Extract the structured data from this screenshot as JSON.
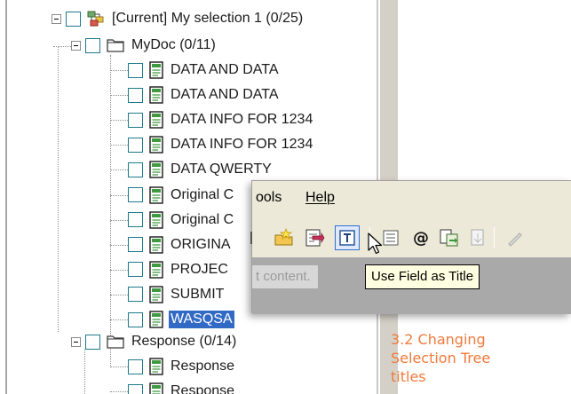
{
  "tree": {
    "root": {
      "label": "[Current] My selection 1  (0/25)"
    },
    "mydoc": {
      "label": "MyDoc  (0/11)",
      "items": [
        "DATA AND DATA",
        "DATA AND DATA",
        "DATA INFO FOR 1234",
        "DATA INFO FOR 1234",
        "DATA QWERTY",
        "Original C",
        "Original C",
        "ORIGINA",
        "PROJEC",
        "SUBMIT",
        "WASQSA"
      ]
    },
    "response": {
      "label": "Response  (0/14)",
      "items": [
        "Response",
        "Response"
      ]
    }
  },
  "toolbar_popup": {
    "menu": {
      "tools": "ools",
      "help": "Help"
    },
    "content_hint": "t content.",
    "tooltip": "Use Field as Title"
  },
  "caption": {
    "line1": "3.2   Changing",
    "line2": "Selection Tree",
    "line3": "titles"
  },
  "colors": {
    "selection": "#316ac5",
    "checkbox_border": "#1e7a8c",
    "caption": "#f07a3a",
    "tooltip_bg": "#ffffe1"
  },
  "icons": {
    "document": "document-icon",
    "folder": "folder-icon",
    "selection": "selection-tree-icon"
  }
}
